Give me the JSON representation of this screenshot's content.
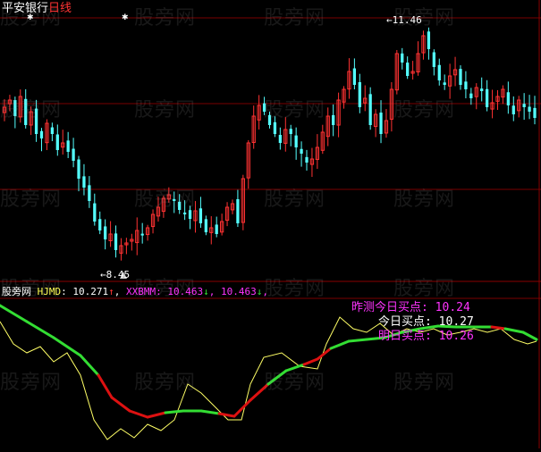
{
  "colors": {
    "background": "#000000",
    "gridline": "#7a0000",
    "divider": "#8a0000",
    "candle_up": "#ff3232",
    "candle_down": "#54ffff",
    "text_white": "#ffffff",
    "text_red": "#ff3333",
    "text_magenta": "#ff33ff",
    "text_yellow": "#ffff55",
    "line_green": "#33dd33",
    "line_red": "#dd1111",
    "line_thin": "#ffff66"
  },
  "watermark": "股旁网",
  "title": {
    "stock_name": "平安银行",
    "period": "日线"
  },
  "price_panel": {
    "high_label": "11.46",
    "low_label": "8.45",
    "high_value": 11.46,
    "low_value": 8.45,
    "star_glyph": "✱"
  },
  "indicator_header": {
    "panel_name": "股旁网",
    "field1_name": "HJMD",
    "field1_value": "10.271",
    "field1_arrow": "↑",
    "field2_name": "XXBMM",
    "field2_value": "10.463",
    "field2_arrow": "↓",
    "field3_value": "10.463",
    "field3_arrow": "↓"
  },
  "indicator_labels": {
    "yesterday_label": "昨测今日买点",
    "yesterday_value": "10.24",
    "today_label": "今日买点",
    "today_value": "10.27",
    "tomorrow_label": "明日买点",
    "tomorrow_value": "10.26"
  },
  "chart_data": {
    "type": "candlestick",
    "price_high": 11.46,
    "price_low": 8.45,
    "series": [
      {
        "name": "HJMD",
        "values": [
          10.1,
          10.2,
          10.1,
          10.0,
          9.9,
          9.7,
          9.5,
          9.3,
          9.2,
          9.3,
          9.4,
          9.5,
          9.6,
          9.7,
          9.8,
          10.0,
          10.1,
          10.2,
          10.3,
          10.271
        ]
      },
      {
        "name": "XXBMM",
        "values": [
          10.5,
          10.4,
          10.3,
          10.2,
          10.0,
          9.8,
          9.6,
          9.5,
          9.5,
          9.5,
          9.6,
          9.7,
          9.8,
          10.0,
          10.1,
          10.2,
          10.3,
          10.4,
          10.5,
          10.463
        ]
      }
    ]
  }
}
